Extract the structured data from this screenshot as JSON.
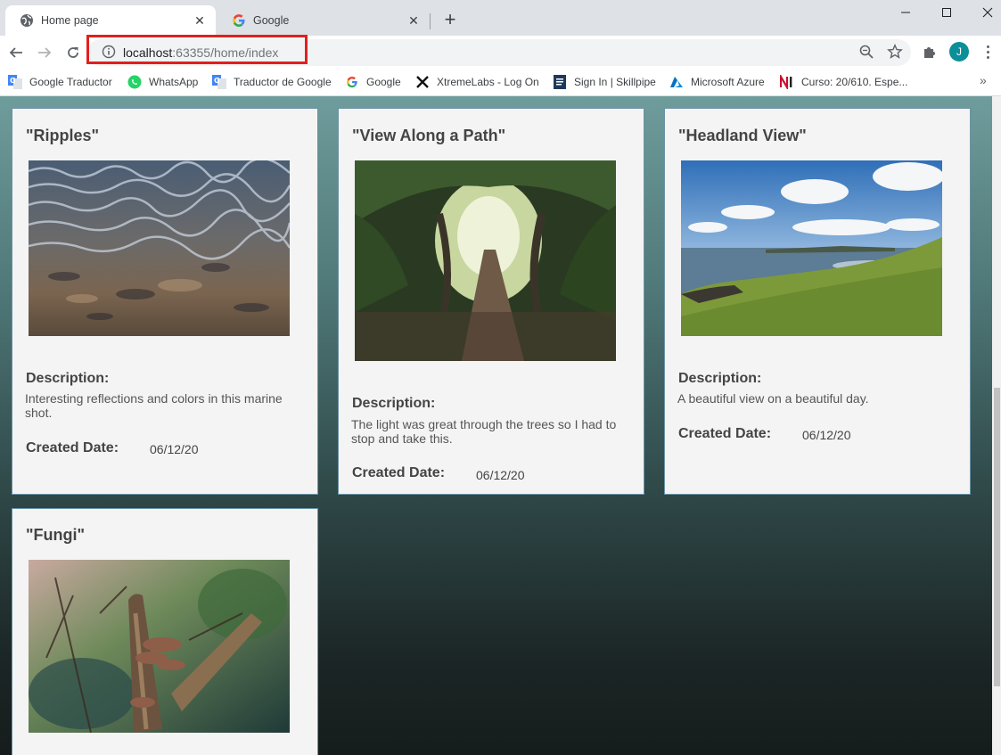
{
  "browser": {
    "tabs": [
      {
        "title": "Home page",
        "icon": "globe-icon",
        "active": true
      },
      {
        "title": "Google",
        "icon": "google-icon",
        "active": false
      }
    ],
    "url": {
      "host": "localhost",
      "rest": ":63355/home/index"
    },
    "profile_initial": "J",
    "accent_color": "#0b8f98",
    "highlight_color": "#e0201e"
  },
  "bookmarks": [
    {
      "label": "Google Traductor",
      "icon": "google-translate-icon"
    },
    {
      "label": "WhatsApp",
      "icon": "whatsapp-icon"
    },
    {
      "label": "Traductor de Google",
      "icon": "google-translate-icon"
    },
    {
      "label": "Google",
      "icon": "google-icon"
    },
    {
      "label": "XtremeLabs - Log On",
      "icon": "xtremelabs-icon"
    },
    {
      "label": "Sign In | Skillpipe",
      "icon": "skillpipe-icon"
    },
    {
      "label": "Microsoft Azure",
      "icon": "azure-icon"
    },
    {
      "label": "Curso: 20/610. Espe...",
      "icon": "ni-icon"
    }
  ],
  "gallery": {
    "description_label": "Description:",
    "date_label": "Created Date:",
    "photos": [
      {
        "title": "\"Ripples\"",
        "description": "Interesting reflections and colors in this marine shot.",
        "date": "06/12/20"
      },
      {
        "title": "\"View Along a Path\"",
        "description": "The light was great through the trees so I had to stop and take this.",
        "date": "06/12/20"
      },
      {
        "title": "\"Headland View\"",
        "description": "A beautiful view on a beautiful day.",
        "date": "06/12/20"
      },
      {
        "title": "\"Fungi\"",
        "description": "",
        "date": ""
      }
    ]
  }
}
